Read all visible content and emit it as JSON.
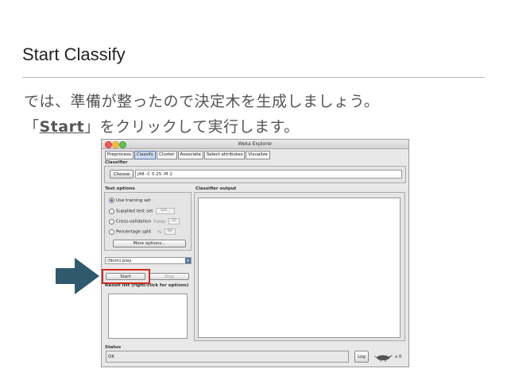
{
  "slide": {
    "title": "Start Classify",
    "line1": "では、準備が整ったので決定木を生成しましょう。",
    "line2_prefix": "「",
    "line2_strong": "Start",
    "line2_suffix": "」をクリックして実行します。"
  },
  "window": {
    "title": "Weka Explorer",
    "tabs": [
      "Preprocess",
      "Classify",
      "Cluster",
      "Associate",
      "Select attributes",
      "Visualize"
    ],
    "active_tab": "Classify",
    "classifier": {
      "section": "Classifier",
      "choose_label": "Choose",
      "value": "J48 -C 0.25 -M 2"
    },
    "test_options": {
      "section": "Test options",
      "use_training": "Use training set",
      "supplied_test": "Supplied test set",
      "set_label": "Set...",
      "cross_validation": "Cross-validation",
      "folds_label": "Folds",
      "folds_value": "10",
      "percentage_split": "Percentage split",
      "percent_label": "%",
      "percent_value": "66",
      "more_options": "More options..."
    },
    "class_combo": "(Nom) play",
    "start_label": "Start",
    "stop_label": "Stop",
    "result_list": "Result list (right-click for options)",
    "classifier_output": "Classifier output",
    "status": {
      "section": "Status",
      "text": "OK",
      "log_label": "Log",
      "count": "x 0"
    }
  },
  "colors": {
    "highlight": "#d62b1e",
    "arrow": "#2f5a6e",
    "active_tab": "#d0dcf0"
  }
}
